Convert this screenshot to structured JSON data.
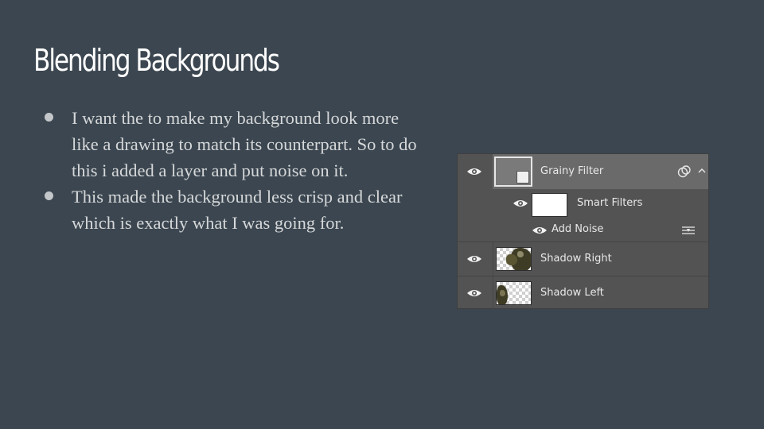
{
  "slide": {
    "title": "Blending Backgrounds",
    "bullets": [
      "I want the to make my background look more like a drawing to match its counterpart. So to do this i added a layer and put noise on it.",
      "This made the background less crisp and clear which is exactly what I was going for."
    ]
  },
  "layers_panel": {
    "layers": [
      {
        "name": "Grainy Filter",
        "selected": true,
        "visible": true,
        "icon": "smart-object-icon"
      },
      {
        "name": "Smart Filters",
        "visible": true
      },
      {
        "name": "Add Noise",
        "visible": true,
        "icon": "filter-options-icon"
      },
      {
        "name": "Shadow Right",
        "visible": true
      },
      {
        "name": "Shadow Left",
        "visible": true
      }
    ]
  },
  "colors": {
    "background": "#3b4650",
    "panel": "#535353",
    "selected_row": "#6a6a6a"
  }
}
